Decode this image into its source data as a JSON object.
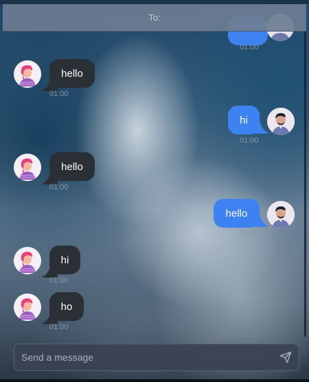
{
  "header": {
    "to_label": "To:"
  },
  "messages": [
    {
      "side": "out",
      "text": "",
      "time": "01:00"
    },
    {
      "side": "in",
      "text": "hello",
      "time": "01:00"
    },
    {
      "side": "out",
      "text": "hi",
      "time": "01:00"
    },
    {
      "side": "in",
      "text": "hello",
      "time": "01:00"
    },
    {
      "side": "out",
      "text": "hello",
      "time": "01:00"
    },
    {
      "side": "in",
      "text": "hi",
      "time": "01:00"
    },
    {
      "side": "in",
      "text": "ho",
      "time": "01:00"
    }
  ],
  "composer": {
    "placeholder": "Send a message",
    "send_icon": "send-icon"
  },
  "colors": {
    "incoming_bubble": "#2b2f36",
    "outgoing_bubble": "#3d82f0"
  }
}
